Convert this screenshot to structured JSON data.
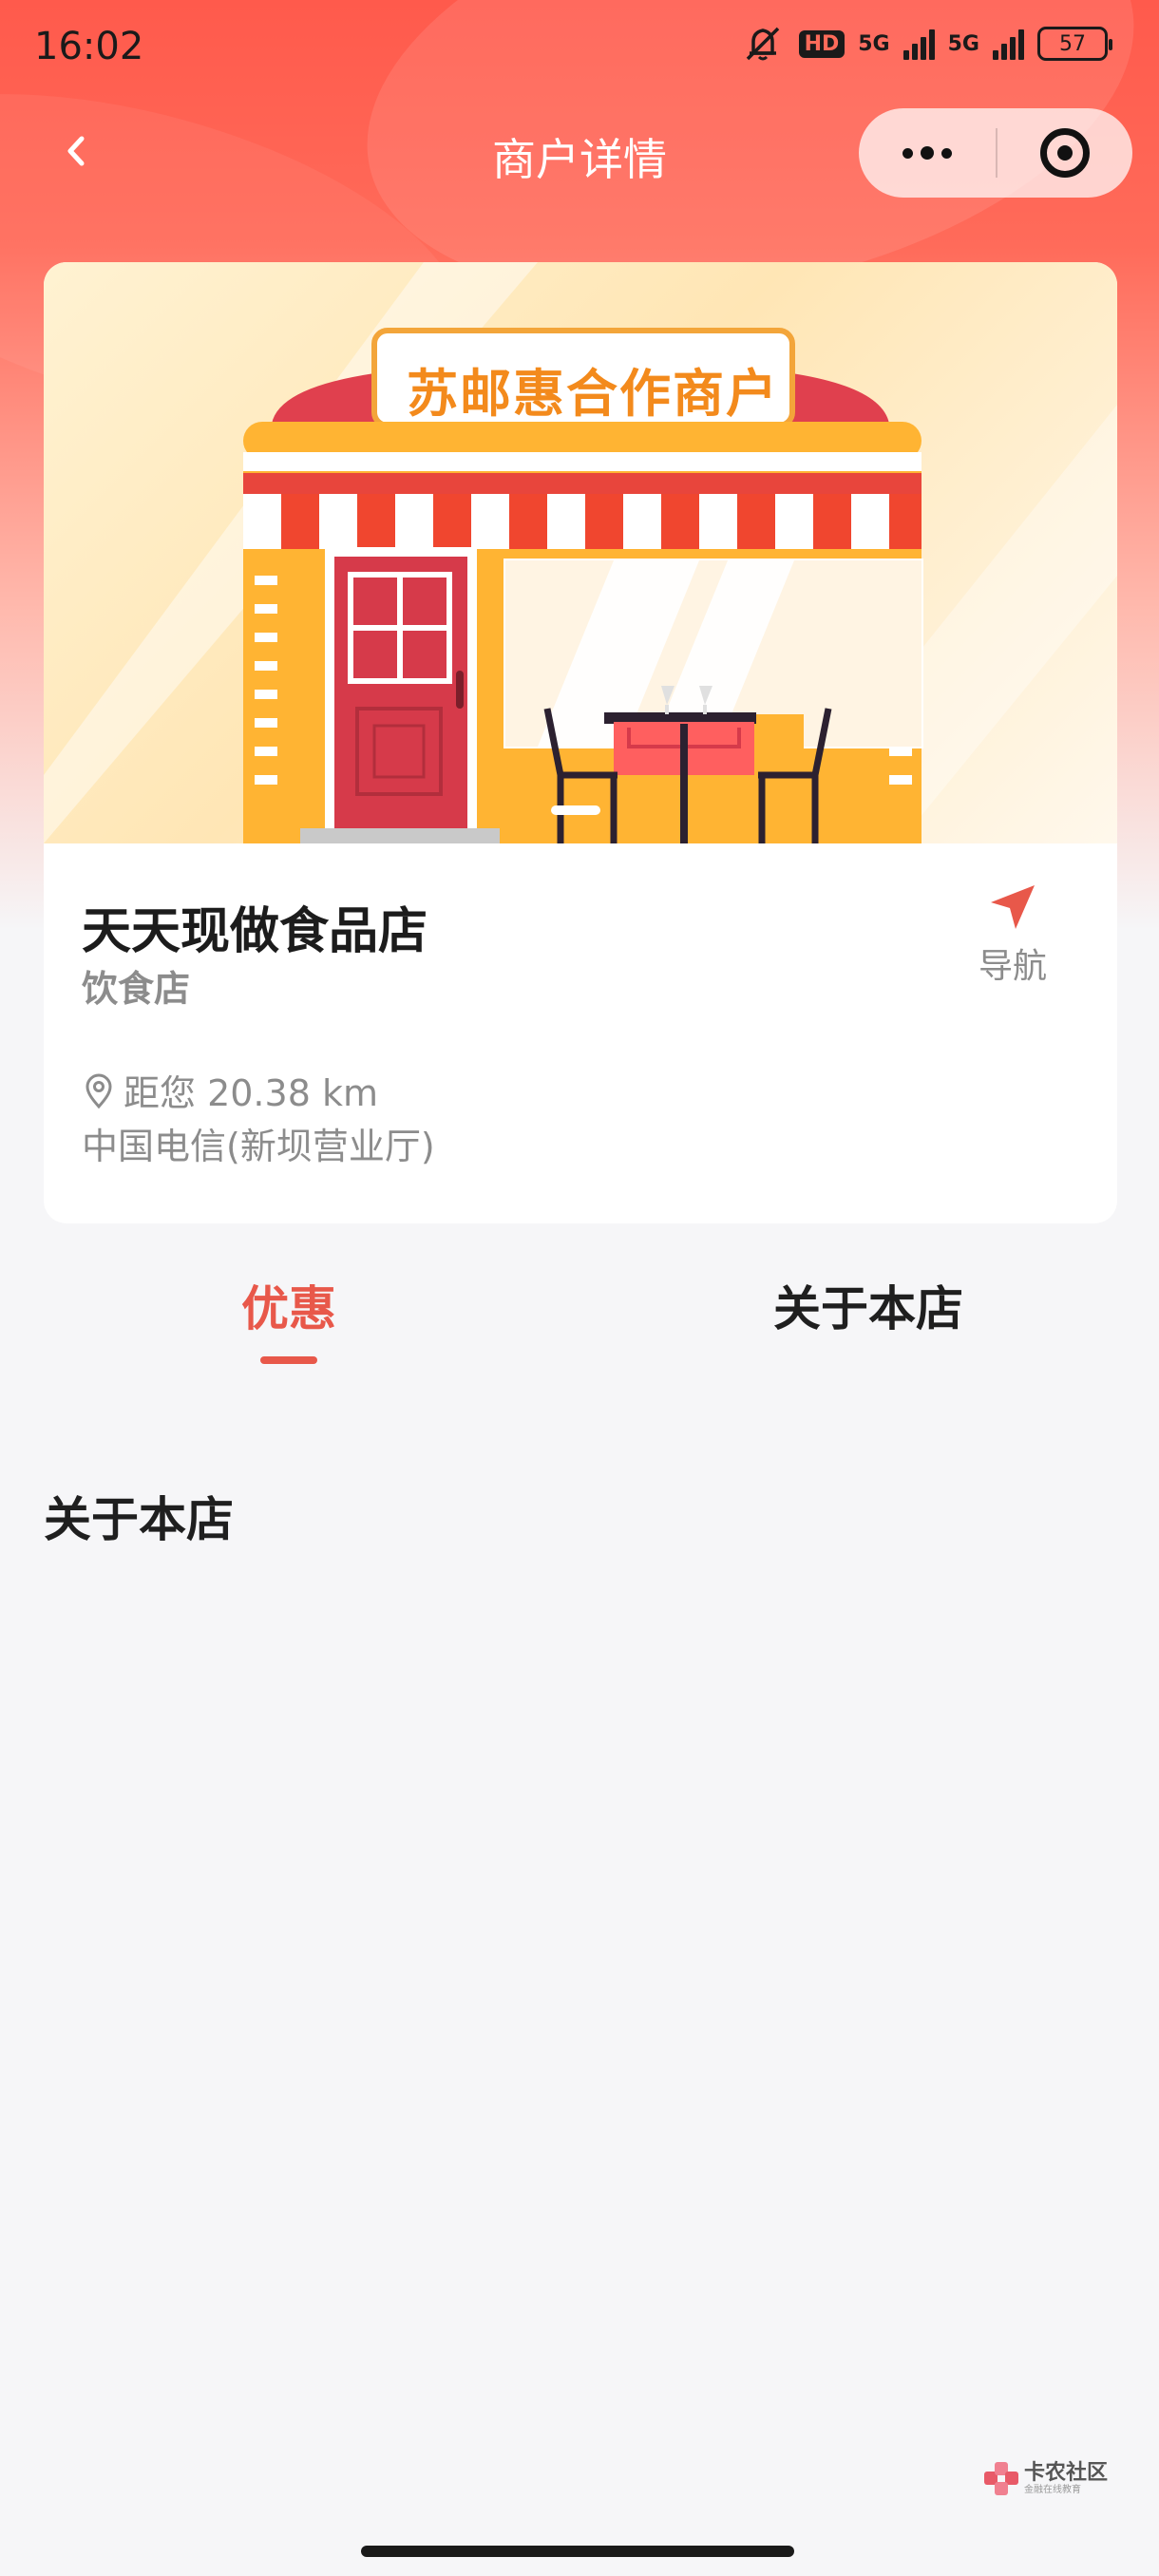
{
  "status_bar": {
    "time": "16:02",
    "hd": "HD",
    "net1": "5G",
    "net2": "5G",
    "battery": "57",
    "icons": [
      "mute-icon",
      "signal-icon",
      "signal-icon",
      "battery-icon"
    ]
  },
  "nav": {
    "title": "商户详情",
    "back_icon": "chevron-left-icon",
    "more_icon": "more-dots-icon",
    "close_icon": "target-close-icon"
  },
  "banner": {
    "sign": "苏邮惠合作商户"
  },
  "shop": {
    "name": "天天现做食品店",
    "category": "饮食店",
    "navigate_label": "导航",
    "navigate_icon": "navigation-arrow-icon",
    "distance": "距您 20.38 km",
    "distance_icon": "location-pin-icon",
    "address": "中国电信(新坝营业厅)"
  },
  "tabs": [
    {
      "label": "优惠",
      "active": true
    },
    {
      "label": "关于本店",
      "active": false
    }
  ],
  "section": {
    "title": "关于本店"
  },
  "watermark": {
    "text": "卡农社区",
    "sub": "金融在线教育"
  },
  "colors": {
    "accent": "#e8584a",
    "header": "#ff5a4c",
    "sign": "#f38a1c"
  }
}
